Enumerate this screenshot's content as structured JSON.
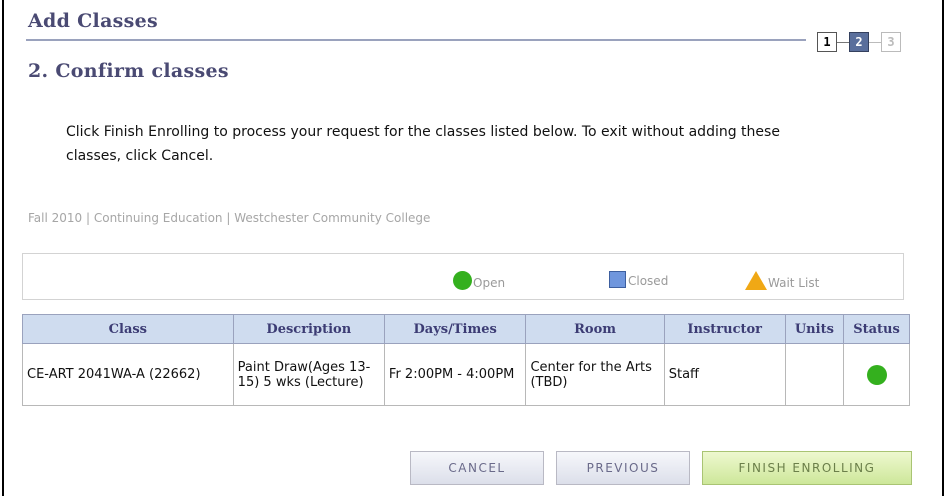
{
  "header": {
    "title": "Add Classes",
    "subtitle": "2. Confirm classes",
    "steps": [
      {
        "label": "1",
        "state": "done"
      },
      {
        "label": "2",
        "state": "current"
      },
      {
        "label": "3",
        "state": "future"
      }
    ]
  },
  "instructions": "Click Finish Enrolling to process your request for the classes listed below. To exit without adding these classes, click Cancel.",
  "term_line": "Fall 2010 | Continuing Education | Westchester Community College",
  "legend": {
    "open": "Open",
    "closed": "Closed",
    "wait_list": "Wait List"
  },
  "table": {
    "headers": [
      "Class",
      "Description",
      "Days/Times",
      "Room",
      "Instructor",
      "Units",
      "Status"
    ],
    "rows": [
      {
        "class": "CE-ART 2041WA-A (22662)",
        "description": "Paint Draw(Ages 13-15) 5 wks (Lecture)",
        "days_times": "Fr 2:00PM - 4:00PM",
        "room": "Center for the Arts (TBD)",
        "instructor": "Staff",
        "units": "",
        "status_icon": "open-status-icon"
      }
    ]
  },
  "buttons": {
    "cancel": "CANCEL",
    "previous": "PREVIOUS",
    "finish": "FINISH ENROLLING"
  },
  "colors": {
    "open": "#34b01e",
    "closed": "#6f96dd",
    "wait_list": "#f0a815",
    "title": "#4a4a73",
    "header_bg": "#cfdcef"
  }
}
